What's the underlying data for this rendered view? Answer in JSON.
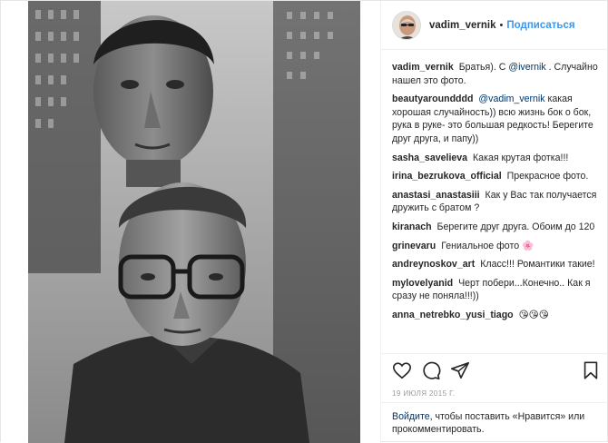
{
  "header": {
    "username": "vadim_vernik",
    "separator": "•",
    "follow_label": "Подписаться"
  },
  "caption": {
    "user": "vadim_vernik",
    "text_before": "Братья). С ",
    "mention": "@ivernik",
    "text_after": " . Случайно нашел это фото."
  },
  "comments": [
    {
      "user": "beautyaroundddd",
      "mention": "@vadim_vernik",
      "text": " какая хорошая случайность)) всю жизнь бок о бок, рука в руке- это большая редкость! Берегите друг друга, и папу))"
    },
    {
      "user": "sasha_savelieva",
      "mention": "",
      "text": "Какая крутая фотка!!!"
    },
    {
      "user": "irina_bezrukova_official",
      "mention": "",
      "text": "Прекрасное фото."
    },
    {
      "user": "anastasi_anastasiii",
      "mention": "",
      "text": "Как у Вас так получается дружить с братом ?"
    },
    {
      "user": "kiranach",
      "mention": "",
      "text": "Берегите друг друга. Обоим до 120"
    },
    {
      "user": "grinevaru",
      "mention": "",
      "text": "Гениальное фото 🌸"
    },
    {
      "user": "andreynoskov_art",
      "mention": "",
      "text": "Класс!!! Романтики такие!"
    },
    {
      "user": "mylovelyanid",
      "mention": "",
      "text": "Черт побери...Конечно.. Как я сразу не поняла!!!))"
    },
    {
      "user": "anna_netrebko_yusi_tiago",
      "mention": "",
      "text": "😘😘😘"
    }
  ],
  "date": "19 ИЮЛЯ 2015 Г.",
  "login": {
    "link": "Войдите",
    "text": ", чтобы поставить «Нравится» или прокомментировать."
  },
  "icons": {
    "like": "heart-icon",
    "comment": "comment-icon",
    "share": "share-icon",
    "save": "bookmark-icon"
  }
}
